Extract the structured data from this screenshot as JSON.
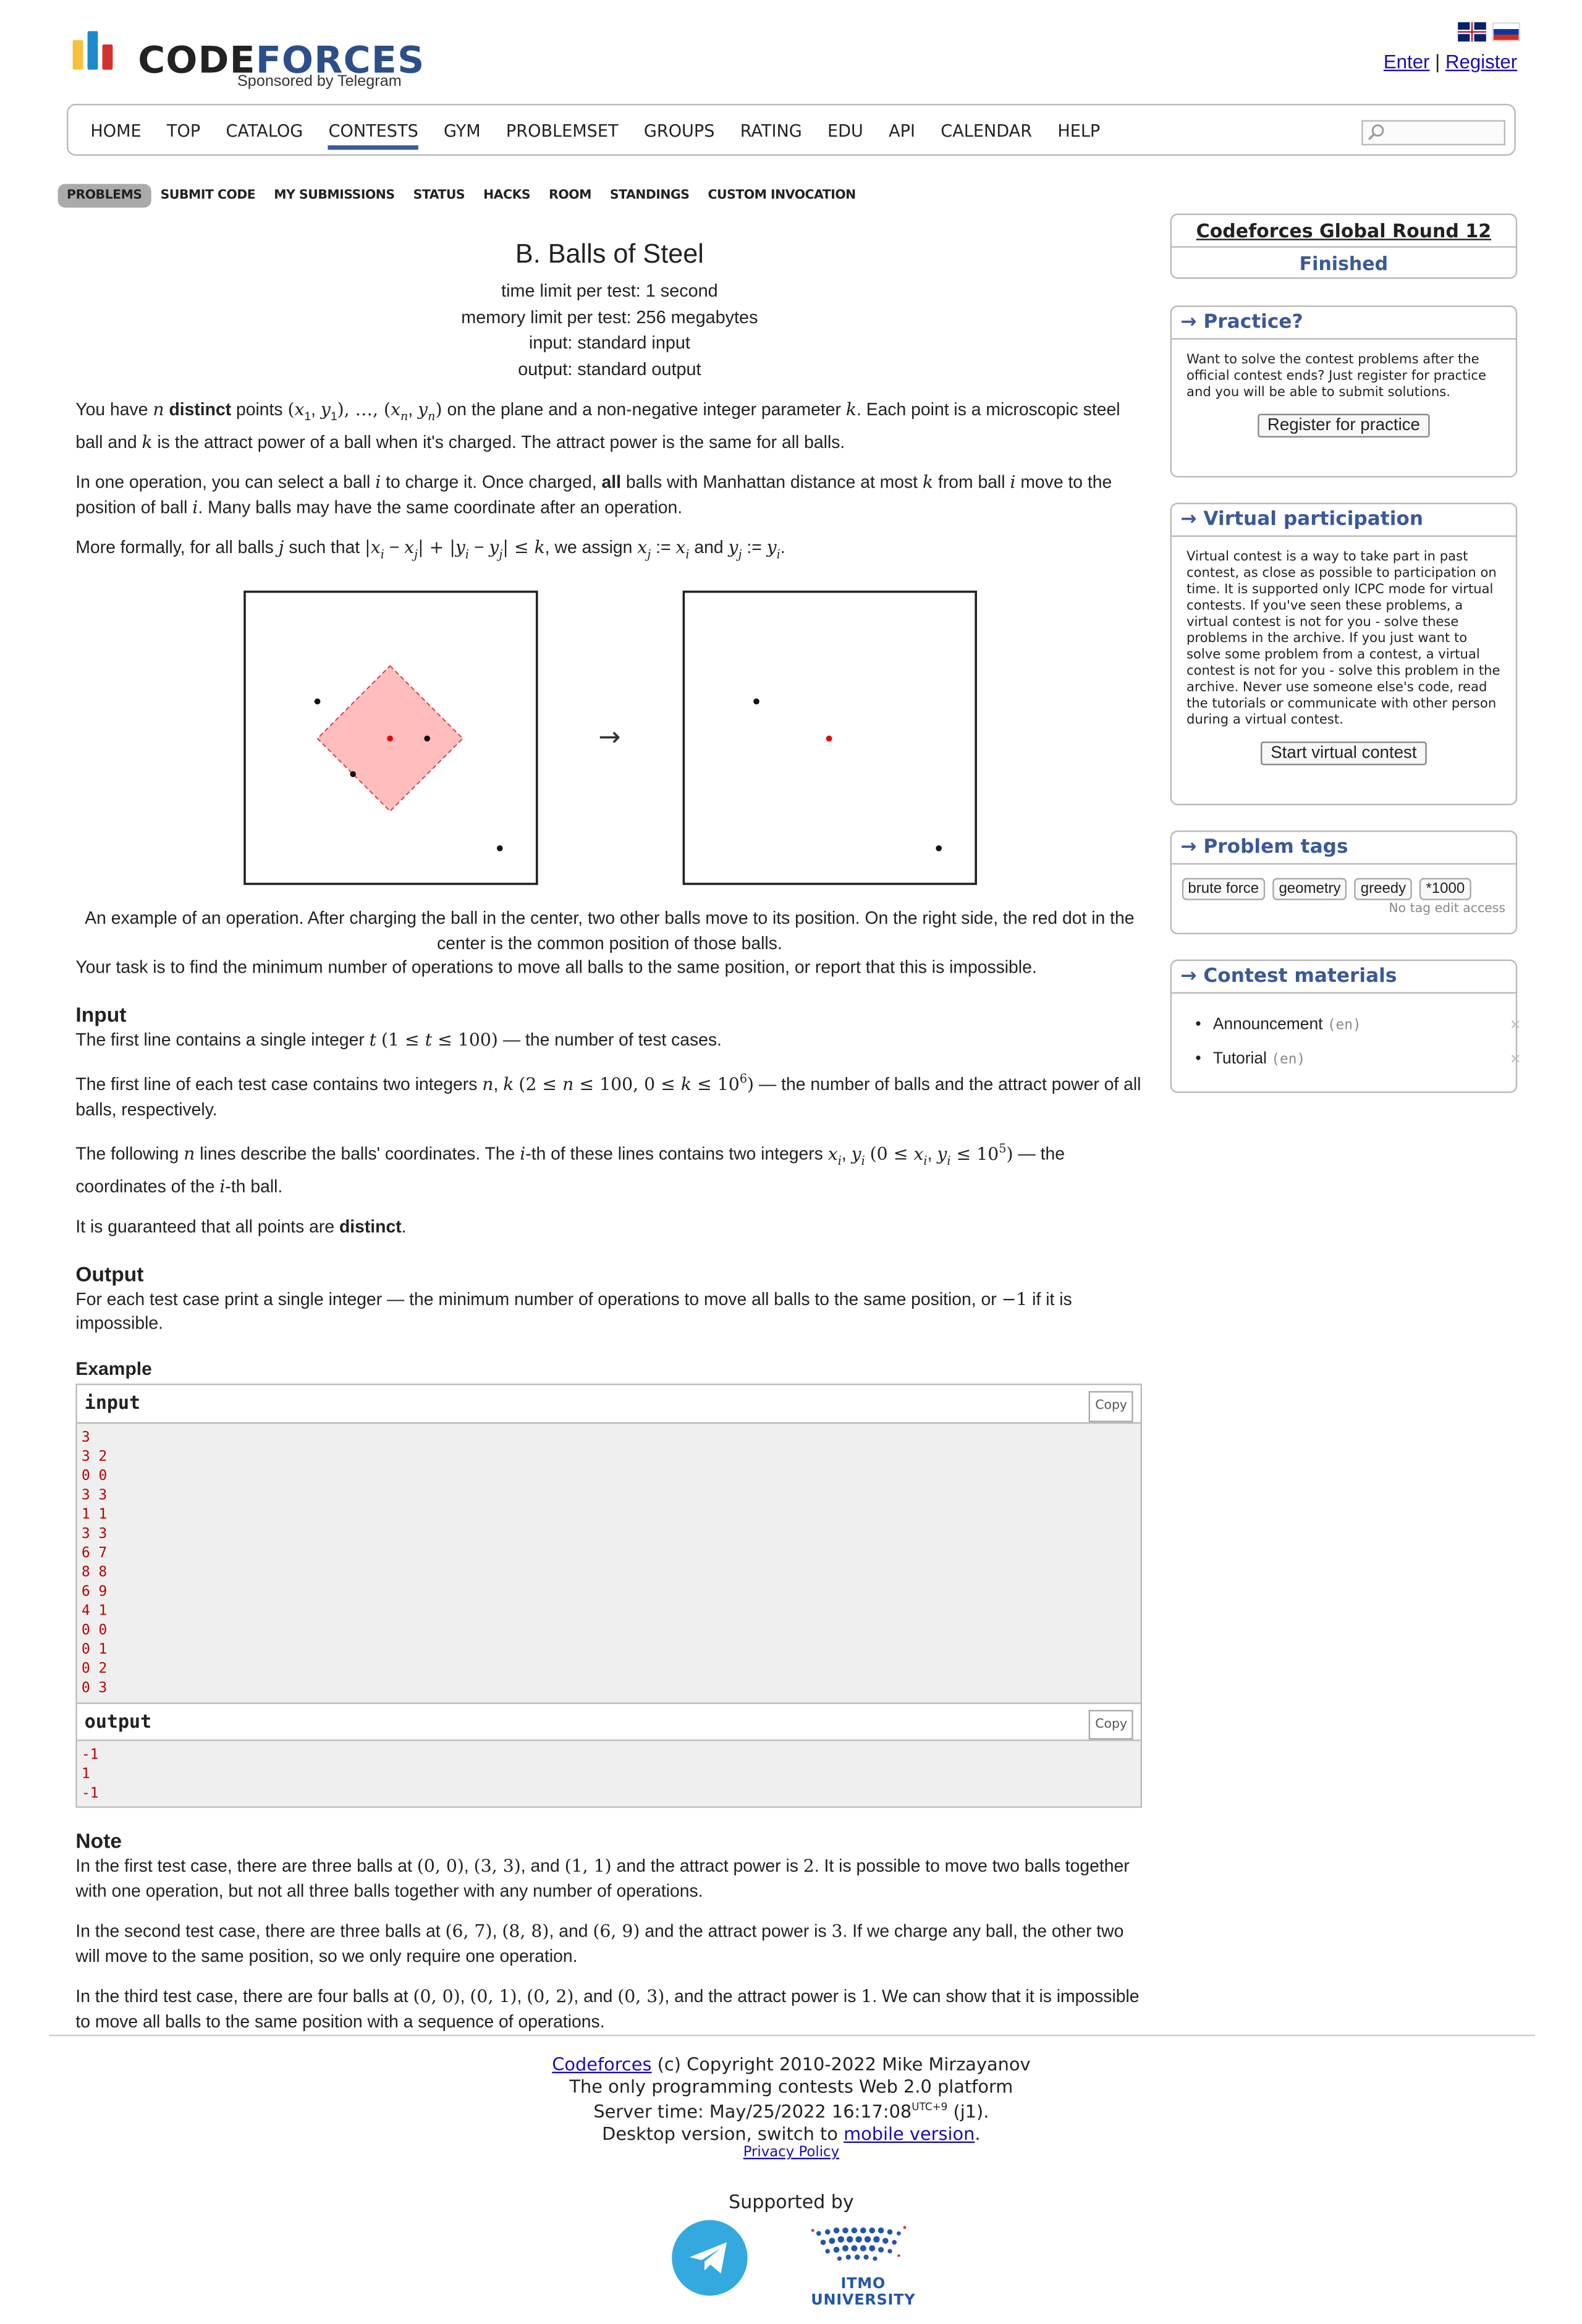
{
  "header": {
    "logo_part1": "CODE",
    "logo_part2": "FORCES",
    "sponsor": "Sponsored by Telegram",
    "enter": "Enter",
    "separator": "|",
    "register": "Register"
  },
  "nav": {
    "items": [
      "HOME",
      "TOP",
      "CATALOG",
      "CONTESTS",
      "GYM",
      "PROBLEMSET",
      "GROUPS",
      "RATING",
      "EDU",
      "API",
      "CALENDAR",
      "HELP"
    ],
    "active": "CONTESTS"
  },
  "submenu": {
    "items": [
      "PROBLEMS",
      "SUBMIT CODE",
      "MY SUBMISSIONS",
      "STATUS",
      "HACKS",
      "ROOM",
      "STANDINGS",
      "CUSTOM INVOCATION"
    ],
    "selected": "PROBLEMS"
  },
  "problem": {
    "title": "B. Balls of Steel",
    "time_limit": "time limit per test: 1 second",
    "memory_limit": "memory limit per test: 256 megabytes",
    "input": "input: standard input",
    "output": "output: standard output",
    "caption": "An example of an operation. After charging the ball in the center, two other balls move to its position. On the right side, the red dot in the center is the common position of those balls.",
    "task": "Your task is to find the minimum number of operations to move all balls to the same position, or report that this is impossible.",
    "input_heading": "Input",
    "output_heading": "Output",
    "output_text_1": "For each test case print a single integer — the minimum number of operations to move all balls to the same position, or ",
    "output_text_2": " if it is impossible.",
    "example_heading": "Example",
    "note_heading": "Note",
    "guarantee_1": "It is guaranteed that all points are ",
    "guarantee_bold": "distinct",
    "arrow": "→"
  },
  "example": {
    "input_label": "input",
    "output_label": "output",
    "copy": "Copy",
    "input_lines": "3\n3 2\n0 0\n3 3\n1 1\n3 3\n6 7\n8 8\n6 9\n4 1\n0 0\n0 1\n0 2\n0 3",
    "output_lines": "-1\n1\n-1"
  },
  "sidebar": {
    "contest_name": "Codeforces Global Round 12",
    "contest_status": "Finished",
    "practice_title": "→ Practice?",
    "practice_text": "Want to solve the contest problems after the official contest ends? Just register for practice and you will be able to submit solutions.",
    "practice_button": "Register for practice",
    "virtual_title": "→ Virtual participation",
    "virtual_text": "Virtual contest is a way to take part in past contest, as close as possible to participation on time. It is supported only ICPC mode for virtual contests. If you've seen these problems, a virtual contest is not for you - solve these problems in the archive. If you just want to solve some problem from a contest, a virtual contest is not for you - solve this problem in the archive. Never use someone else's code, read the tutorials or communicate with other person during a virtual contest.",
    "virtual_button": "Start virtual contest",
    "tags_title": "→ Problem tags",
    "tags": [
      "brute force",
      "geometry",
      "greedy",
      "*1000"
    ],
    "tags_note": "No tag edit access",
    "materials_title": "→ Contest materials",
    "materials": [
      {
        "name": "Announcement",
        "lang": "(en)"
      },
      {
        "name": "Tutorial",
        "lang": "(en)"
      }
    ]
  },
  "footer": {
    "link": "Codeforces",
    "copyright": " (c) Copyright 2010-2022 Mike Mirzayanov",
    "tagline": "The only programming contests Web 2.0 platform",
    "server_time": "Server time: May/25/2022 16:17:08",
    "tz": "UTC+9",
    "server_suffix": " (j1).",
    "desktop_1": "Desktop version, switch to ",
    "mobile_link": "mobile version",
    "desktop_2": ".",
    "privacy": "Privacy Policy",
    "supported_by": "Supported by",
    "itmo": "ITMO UNIVERSITY"
  },
  "colors": {
    "accent": "#3b5998",
    "logo_yellow": "#f6c23e",
    "logo_blue": "#1f8acb",
    "logo_red": "#d62f2f",
    "telegram": "#34a9e0",
    "itmo": "#2356a8"
  }
}
